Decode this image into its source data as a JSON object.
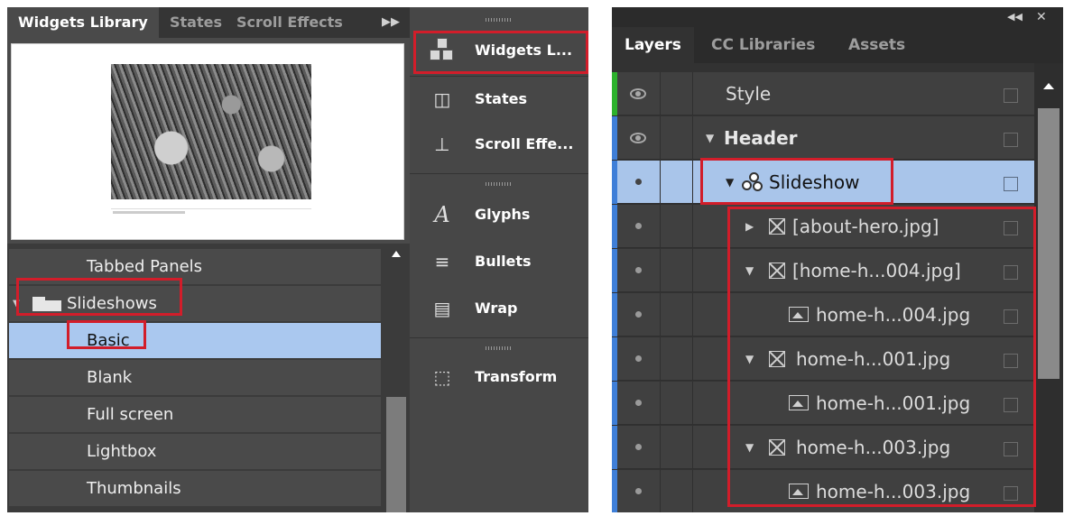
{
  "widgets_panel": {
    "tabs": [
      "Widgets Library",
      "States",
      "Scroll Effects"
    ],
    "items": [
      {
        "label": "Tabbed Panels"
      },
      {
        "label": "Slideshows"
      },
      {
        "label": "Basic"
      },
      {
        "label": "Blank"
      },
      {
        "label": "Full screen"
      },
      {
        "label": "Lightbox"
      },
      {
        "label": "Thumbnails"
      }
    ]
  },
  "tool_strip": {
    "tools": [
      {
        "label": "Widgets L...",
        "icon": "widgets-cube-icon"
      },
      {
        "label": "States",
        "icon": "states-icon"
      },
      {
        "label": "Scroll Effe...",
        "icon": "scroll-effects-icon"
      },
      {
        "label": "Glyphs",
        "icon": "glyph-a-icon"
      },
      {
        "label": "Bullets",
        "icon": "bullets-icon"
      },
      {
        "label": "Wrap",
        "icon": "wrap-icon"
      },
      {
        "label": "Transform",
        "icon": "transform-icon"
      }
    ]
  },
  "layers_panel": {
    "tabs": [
      "Layers",
      "CC Libraries",
      "Assets"
    ],
    "rows": [
      {
        "name": "Style"
      },
      {
        "name": "Header"
      },
      {
        "name": "Slideshow"
      },
      {
        "name": "[about-hero.jpg]"
      },
      {
        "name": "[home-h...004.jpg]"
      },
      {
        "name": "home-h...004.jpg"
      },
      {
        "name": "home-h...001.jpg"
      },
      {
        "name": "home-h...001.jpg"
      },
      {
        "name": "home-h...003.jpg"
      },
      {
        "name": "home-h...003.jpg"
      }
    ]
  },
  "colors": {
    "highlight": "#d21d2a",
    "selection": "#aac8ef",
    "panel": "#4a4a4a",
    "layer_green": "#2db22d",
    "layer_blue": "#3f7fd8"
  }
}
